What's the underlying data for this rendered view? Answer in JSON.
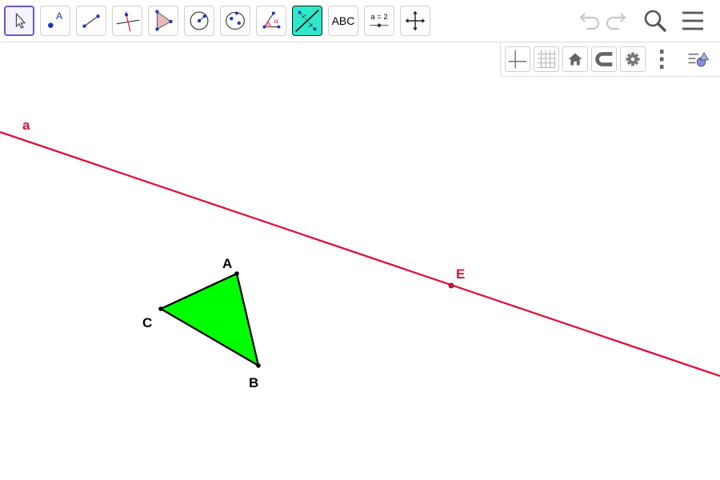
{
  "toolbar": {
    "tools": [
      {
        "name": "move-tool",
        "selected": true
      },
      {
        "name": "point-tool",
        "icon_text": "A"
      },
      {
        "name": "segment-tool"
      },
      {
        "name": "perpendicular-line-tool"
      },
      {
        "name": "polygon-tool"
      },
      {
        "name": "circle-tool"
      },
      {
        "name": "conic-tool"
      },
      {
        "name": "angle-tool",
        "icon_text": "α"
      },
      {
        "name": "reflect-tool"
      },
      {
        "name": "text-tool",
        "label": "ABC"
      },
      {
        "name": "slider-tool",
        "label": "a = 2"
      },
      {
        "name": "move-graphics-view-tool"
      }
    ],
    "actions": [
      "undo-icon",
      "redo-icon",
      "search-icon",
      "menu-icon"
    ]
  },
  "stylebar": {
    "buttons": [
      "axes-toggle-icon",
      "grid-toggle-icon",
      "home-icon",
      "magnet-icon",
      "settings-icon",
      "more-icon",
      "algebra-view-toggle-icon"
    ]
  },
  "graphics": {
    "colors": {
      "line": "#e0103c",
      "triangle_fill": "#00ff00",
      "triangle_stroke": "#000000",
      "point": "#000000"
    },
    "labels": {
      "line_a": "a",
      "point_A": "A",
      "point_B": "B",
      "point_C": "C",
      "point_E": "E"
    }
  }
}
